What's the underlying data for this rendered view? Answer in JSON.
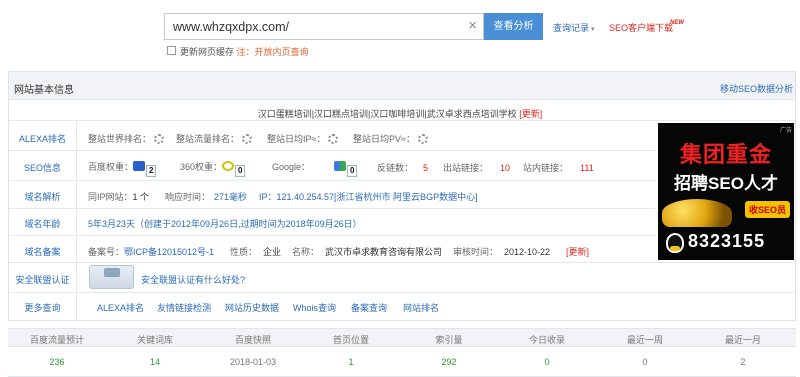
{
  "search": {
    "value": "www.whzqxdpx.com/",
    "clear_icon": "close-icon",
    "button_label": "查看分析",
    "history_label": "查询记录",
    "history_caret": "▾",
    "seo_download_label": "SEO客户端下载",
    "new_badge": "NEW",
    "checkbox_label": "更新网页缓存",
    "checkbox_note": "注：开放内页查询"
  },
  "panel": {
    "title": "网站基本信息",
    "mobile_link": "移动SEO数据分析",
    "site_title": "汉口蛋糕培训|汉口糕点培训|汉口咖啡培训|武汉卓求西点培训学校",
    "site_title_update": "[更新]"
  },
  "rows": {
    "alexa": {
      "label": "ALEXA排名",
      "world_rank": "整站世界排名：",
      "traffic_rank": "整站流量排名：",
      "daily_ip": "整站日均IP≈：",
      "daily_pv": "整站日均PV≈："
    },
    "seo": {
      "label": "SEO信息",
      "baidu_weight": "百度权重：",
      "baidu_value": "2",
      "w360": "360权重：",
      "w360_value": "0",
      "google": "Google：",
      "google_value": "0",
      "backlinks": "反链数：",
      "backlinks_value": "5",
      "outlinks": "出站链接：",
      "outlinks_value": "10",
      "inlinks": "站内链接：",
      "inlinks_value": "111"
    },
    "domain": {
      "label": "域名解析",
      "same_ip": "同IP网站：",
      "same_ip_value": "1 个",
      "resp_time": "响应时间：",
      "resp_time_value": "271毫秒",
      "ip": "IP：121.40.254.57[浙江省杭州市 阿里云BGP数据中心]"
    },
    "age": {
      "label": "域名年龄",
      "value": "5年3月23天（创建于2012年09月26日,过期时间为2018年09月26日）"
    },
    "icp": {
      "label": "域名备案",
      "icp_no": "备案号：",
      "icp_no_value": "鄂ICP备12015012号-1",
      "nature": "性质：",
      "nature_value": "企业",
      "name": "名称：",
      "name_value": "武汉市卓求教育咨询有限公司",
      "audit": "审核时间：",
      "audit_value": "2012-10-22",
      "update": "[更新]"
    },
    "cert": {
      "label": "安全联盟认证",
      "link": "安全联盟认证有什么好处?"
    },
    "more": {
      "label": "更多查询",
      "links": [
        "ALEXA排名",
        "友情链接检测",
        "网站历史数据",
        "Whois查询",
        "备案查询",
        "网站排名"
      ]
    }
  },
  "ad": {
    "tag": "广告",
    "line1": "集团重金",
    "line2": "招聘SEO人才",
    "sub": "收SEO员",
    "phone": "8323155"
  },
  "stats": {
    "headers": [
      "百度流量预计",
      "关键词库",
      "百度快照",
      "首页位置",
      "索引量",
      "今日收录",
      "最近一周",
      "最近一月"
    ],
    "values": [
      "236",
      "14",
      "2018-01-03",
      "1",
      "292",
      "0",
      "0",
      "2"
    ]
  },
  "colors": {
    "accent_blue": "#4a8fd6",
    "link_blue": "#2a6ab8",
    "alert_red": "#d9251c",
    "value_green": "#2e9a2e"
  }
}
